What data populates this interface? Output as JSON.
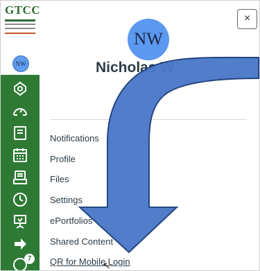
{
  "logo": {
    "text": "GTCC"
  },
  "rail": {
    "avatar_initials": "NW",
    "items": [
      {
        "name": "account",
        "icon": "shield-icon"
      },
      {
        "name": "dashboard",
        "icon": "speedometer-icon"
      },
      {
        "name": "courses",
        "icon": "book-icon"
      },
      {
        "name": "calendar",
        "icon": "calendar-icon"
      },
      {
        "name": "inbox",
        "icon": "inbox-icon"
      },
      {
        "name": "history",
        "icon": "clock-icon"
      },
      {
        "name": "studio",
        "icon": "presentation-icon"
      },
      {
        "name": "logout",
        "icon": "logout-arrow-icon"
      },
      {
        "name": "help",
        "icon": "help-icon",
        "badge": "7"
      }
    ]
  },
  "tray": {
    "close_icon": "×",
    "avatar_initials": "NW",
    "user_name": "Nicholas W",
    "logout_fragment": "ut",
    "links": [
      {
        "label": "Notifications"
      },
      {
        "label": "Profile"
      },
      {
        "label": "Files"
      },
      {
        "label": "Settings"
      },
      {
        "label": "ePortfolios"
      },
      {
        "label": "Shared Content"
      },
      {
        "label": "QR for Mobile Login"
      }
    ]
  },
  "colors": {
    "rail": "#2e7a35",
    "avatar": "#5b98ef",
    "arrow_fill": "#4a78c8",
    "arrow_stroke": "#1f3f7a"
  }
}
